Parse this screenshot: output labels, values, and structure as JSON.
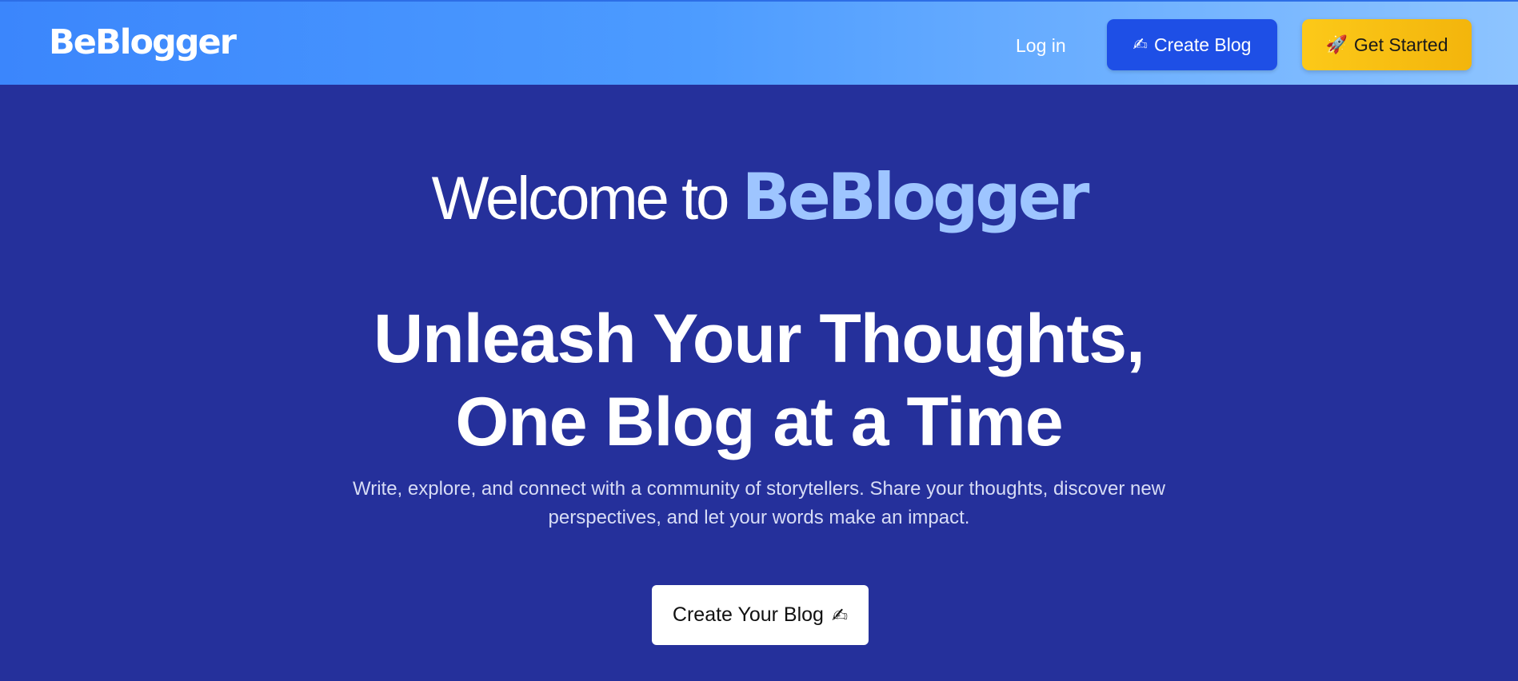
{
  "nav": {
    "logo": "BeBlogger",
    "login_label": "Log in",
    "create_blog": {
      "icon": "✍",
      "label": "Create Blog"
    },
    "get_started": {
      "icon": "🚀",
      "label": "Get Started"
    }
  },
  "hero": {
    "welcome_prefix": "Welcome to ",
    "welcome_brand": "BeBlogger",
    "headline_line1": "Unleash Your Thoughts,",
    "headline_line2": "One Blog at a Time",
    "subtitle_line1": "Write, explore, and connect with a community of storytellers. Share your thoughts, discover new",
    "subtitle_line2": "perspectives, and let your words make an impact.",
    "cta": {
      "label": "Create Your Blog",
      "icon": "✍"
    }
  },
  "colors": {
    "page_bg": "#25309b",
    "nav_gradient_start": "#3b86fc",
    "nav_gradient_end": "#8dc4ff",
    "brand_accent": "#9ec5ff",
    "create_button": "#1e4fe6",
    "get_started_button": "#fcc919"
  }
}
